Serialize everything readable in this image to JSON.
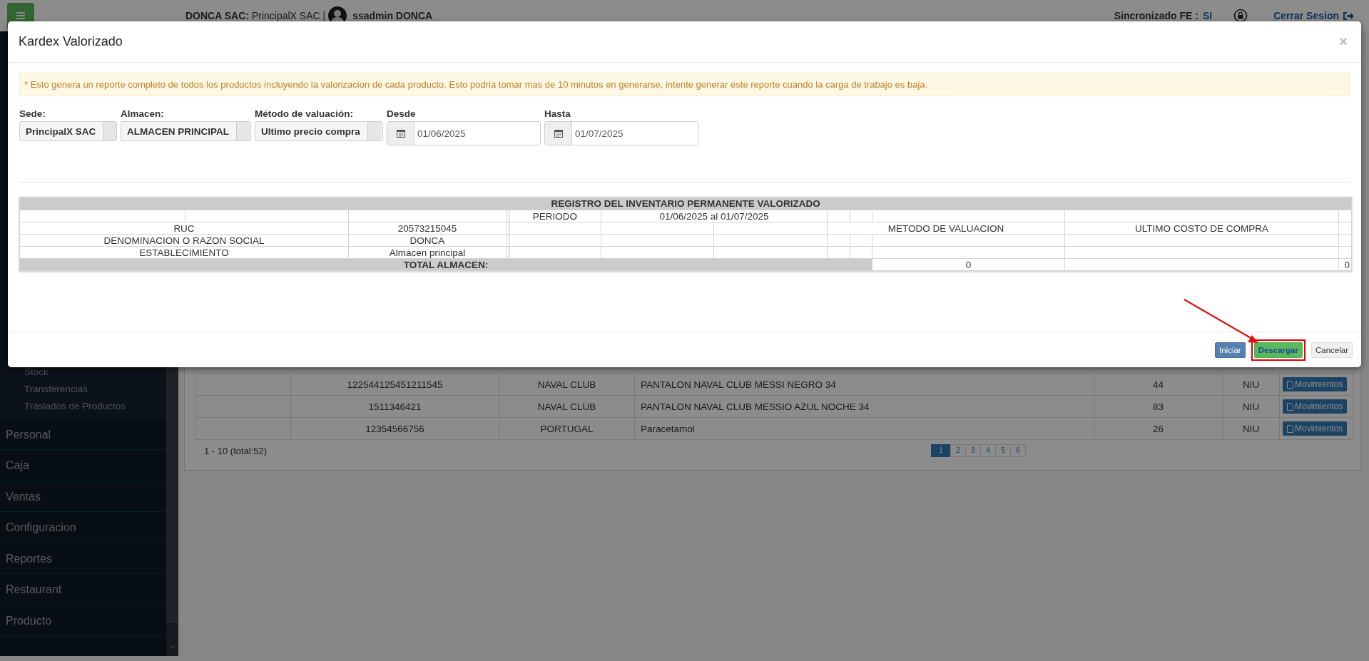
{
  "topbar": {
    "company_label": "DONCA SAC:",
    "company": "PrincipalX SAC |",
    "user": "ssadmin DONCA",
    "sync_label": "Sincronizado FE :",
    "sync_value": "SI",
    "logout": "Cerrar Sesion"
  },
  "sidebar": {
    "subitems": [
      "Stock",
      "Transferencias",
      "Traslados de Productos"
    ],
    "items": [
      "Personal",
      "Caja",
      "Ventas",
      "Configuracion",
      "Reportes",
      "Restaurant",
      "Producto"
    ]
  },
  "products": {
    "rows": [
      {
        "code": "122544125451211545",
        "brand": "NAVAL CLUB",
        "description": "PANTALON NAVAL CLUB MESSI NEGRO 34",
        "quantity": "44",
        "unit": "NIU",
        "action": "Movimientos"
      },
      {
        "code": "1511346421",
        "brand": "NAVAL CLUB",
        "description": "PANTALON NAVAL CLUB MESSIO AZUL NOCHE 34",
        "quantity": "83",
        "unit": "NIU",
        "action": "Movimientos"
      },
      {
        "code": "12354566756",
        "brand": "PORTUGAL",
        "description": "Paracetamol",
        "quantity": "26",
        "unit": "NIU",
        "action": "Movimientos"
      }
    ],
    "summary": "1 - 10 (total:52)",
    "pages": [
      {
        "label": "1",
        "selected": true
      },
      {
        "label": "2",
        "selected": false
      },
      {
        "label": "3",
        "selected": false
      },
      {
        "label": "4",
        "selected": false
      },
      {
        "label": "5",
        "selected": false
      },
      {
        "label": "6",
        "selected": false
      }
    ]
  },
  "modal": {
    "title": "Kardex Valorizado",
    "close": "×",
    "notice": "* Esto genera un reporte completo de todos los productos incluyendo la valorizacion de cada producto. Esto podria tomar mas de 10 minutos en generarse, intente generar este reporte cuando la carga de trabajo es baja.",
    "filters": [
      {
        "kind": "select",
        "label": "Sede:",
        "value": "PrincipalX SAC"
      },
      {
        "kind": "select",
        "label": "Almacen:",
        "value": "ALMACEN PRINCIPAL"
      },
      {
        "kind": "select",
        "label": "Método de valuación:",
        "value": "Ultimo precio compra"
      },
      {
        "kind": "date",
        "label": "Desde",
        "value": "01/06/2025"
      },
      {
        "kind": "date",
        "label": "Hasta",
        "value": "01/07/2025"
      }
    ],
    "report": {
      "title": "REGISTRO DEL INVENTARIO PERMANENTE VALORIZADO",
      "period_label": "PERIODO",
      "period": "01/06/2025 al 01/07/2025",
      "ruc_label": "RUC",
      "ruc": "20573215045",
      "name_label": "DENOMINACION O RAZON SOCIAL",
      "name": "DONCA",
      "establishment_label": "ESTABLECIMIENTO",
      "establishment": "Almacen principal",
      "valuation_label": "METODO DE VALUACION",
      "valuation": "ULTIMO COSTO DE COMPRA",
      "total_label": "TOTAL ALMACEN:",
      "total_quantity": "0",
      "total_value": "0"
    },
    "buttons": [
      {
        "label": "Iniciar",
        "kind": "primary",
        "highlighted": false
      },
      {
        "label": "Descargar",
        "kind": "success",
        "highlighted": true
      },
      {
        "label": "Cancelar",
        "kind": "default",
        "highlighted": false
      }
    ]
  }
}
